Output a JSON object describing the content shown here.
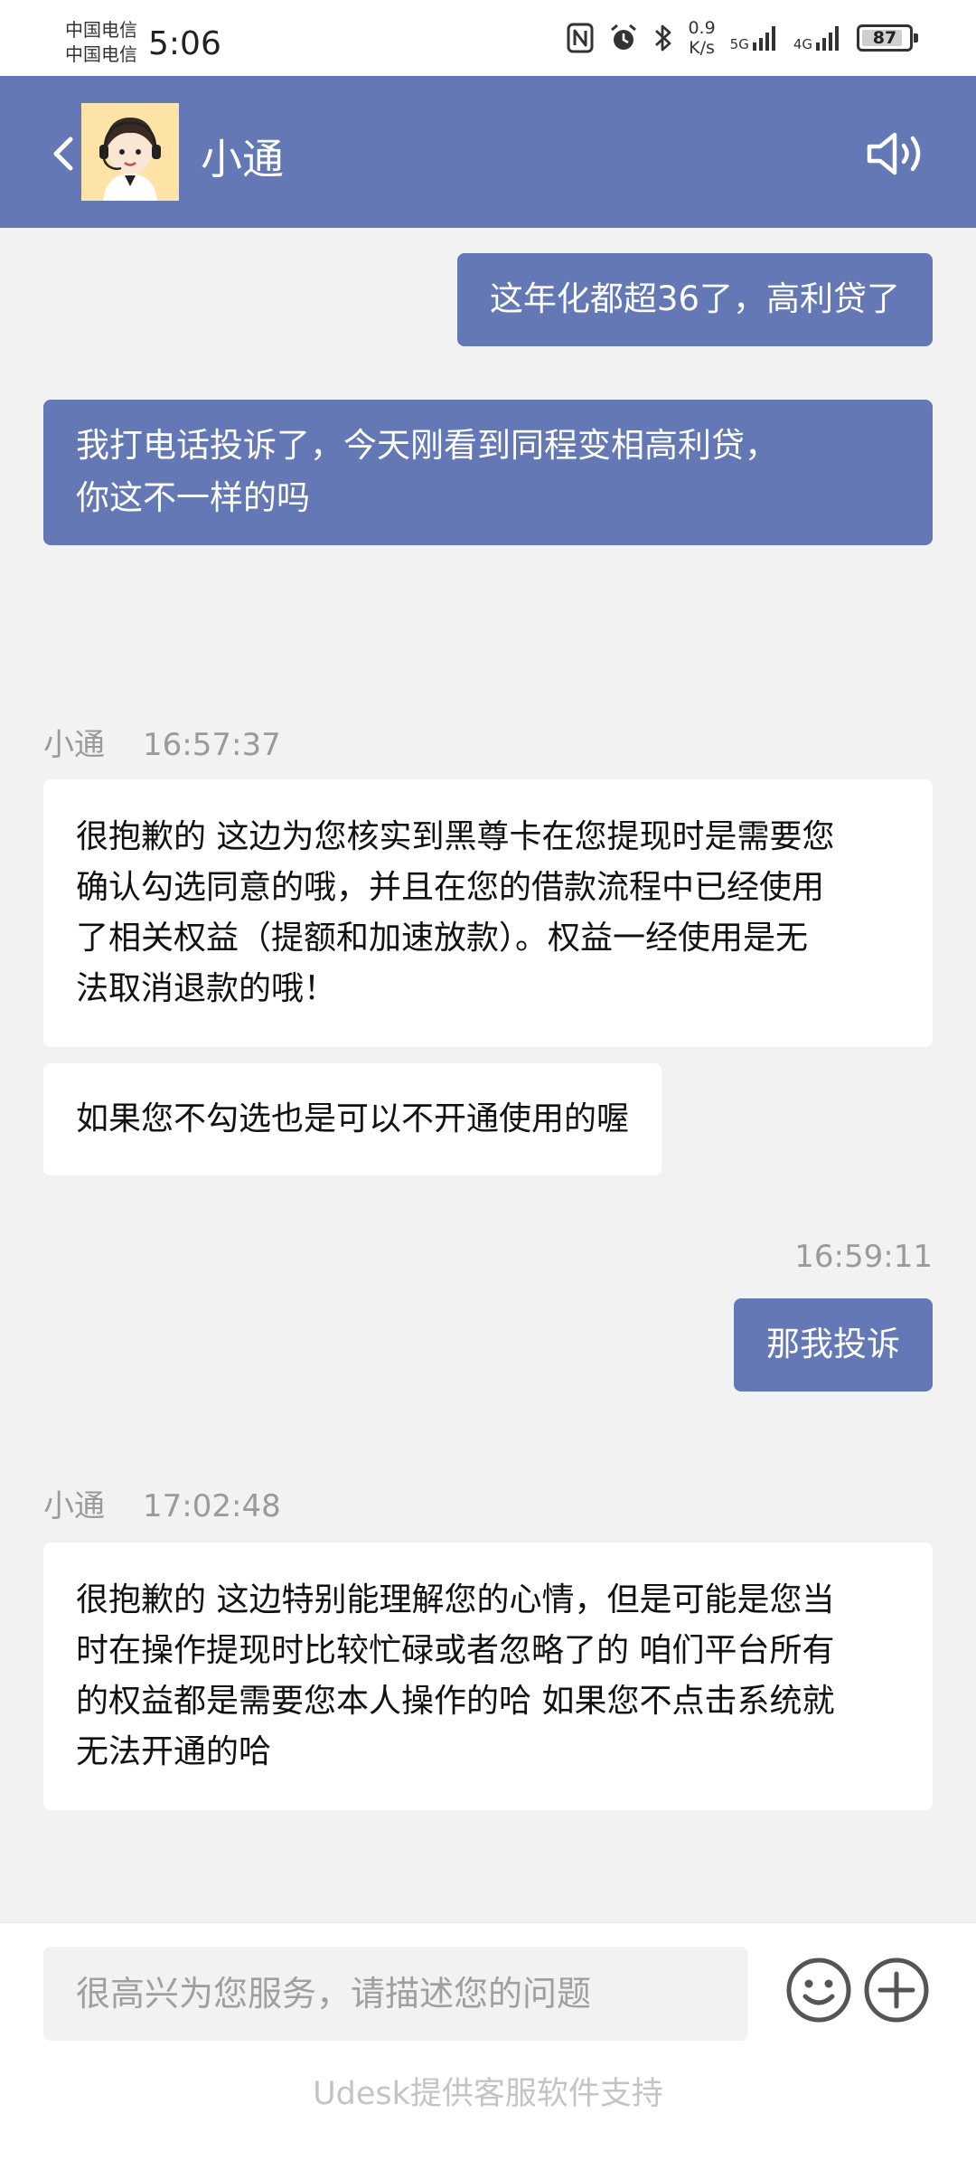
{
  "status_bar": {
    "carrier_1": "中国电信",
    "carrier_2": "中国电信",
    "time": "5:06",
    "net_speed_value": "0.9",
    "net_speed_unit": "K/s",
    "signal_1_label": "5G",
    "signal_2_label": "4G",
    "battery": "87",
    "battery_level": 0.87,
    "icons": [
      "nfc-icon",
      "alarm-icon",
      "bluetooth-icon",
      "signal-icon",
      "battery-icon"
    ]
  },
  "header": {
    "agent_name": "小通",
    "icons": [
      "back-icon",
      "agent-avatar",
      "speaker-icon"
    ],
    "color": "#6378b4"
  },
  "messages": {
    "out_1": "这年化都超36了，高利贷了",
    "out_2_line_1": "我打电话投诉了，今天刚看到同程变相高利贷，",
    "out_2_line_2": "你这不一样的吗",
    "meta_1_sender": "小通",
    "meta_1_time": "16:57:37",
    "in_1_line_1": "很抱歉的 这边为您核实到黑尊卡在您提现时是需要您",
    "in_1_line_2": "确认勾选同意的哦，并且在您的借款流程中已经使用",
    "in_1_line_3": "了相关权益（提额和加速放款）。权益一经使用是无",
    "in_1_line_4": "法取消退款的哦！",
    "in_2": "如果您不勾选也是可以不开通使用的喔",
    "meta_2_time": "16:59:11",
    "out_3": "那我投诉",
    "meta_3_sender": "小通",
    "meta_3_time": "17:02:48",
    "in_3_line_1": "很抱歉的 这边特别能理解您的心情，但是可能是您当",
    "in_3_line_2": "时在操作提现时比较忙碌或者忽略了的 咱们平台所有",
    "in_3_line_3": "的权益都是需要您本人操作的哈 如果您不点击系统就",
    "in_3_line_4": "无法开通的哈"
  },
  "input_bar": {
    "placeholder": "很高兴为您服务，请描述您的问题",
    "icons": [
      "emoji-icon",
      "plus-icon"
    ],
    "powered_by": "Udesk提供客服软件支持"
  },
  "colors": {
    "accent": "#6378b4",
    "chat_background": "#f2f2f2",
    "incoming_bubble": "#ffffff",
    "meta_text": "#9a9a9a"
  }
}
